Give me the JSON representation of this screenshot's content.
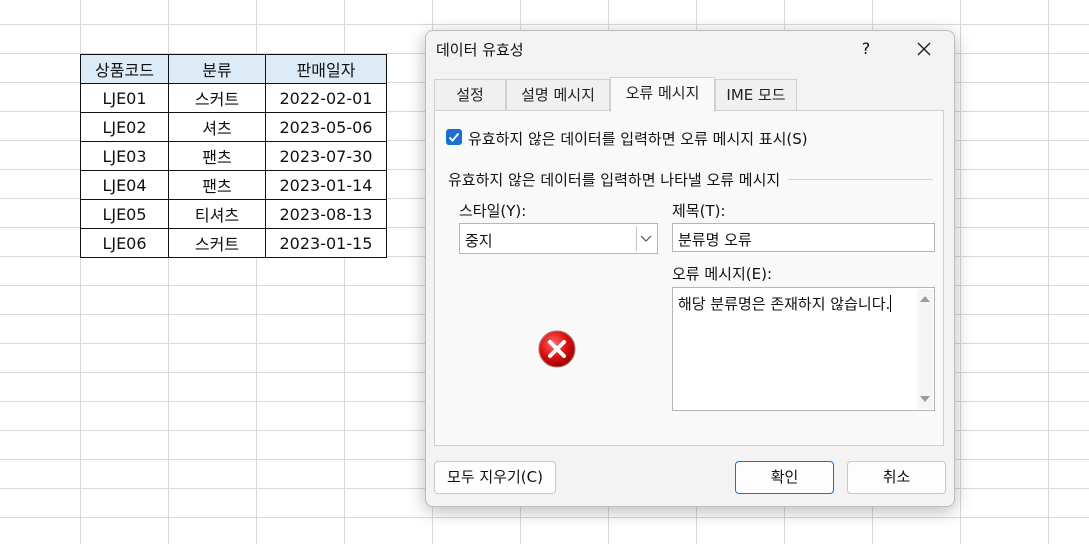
{
  "sheet": {
    "headers": [
      "상품코드",
      "분류",
      "판매일자"
    ],
    "rows": [
      [
        "LJE01",
        "스커트",
        "2022-02-01"
      ],
      [
        "LJE02",
        "셔츠",
        "2023-05-06"
      ],
      [
        "LJE03",
        "팬츠",
        "2023-07-30"
      ],
      [
        "LJE04",
        "팬츠",
        "2023-01-14"
      ],
      [
        "LJE05",
        "티셔츠",
        "2023-08-13"
      ],
      [
        "LJE06",
        "스커트",
        "2023-01-15"
      ]
    ]
  },
  "dialog": {
    "title": "데이터 유효성",
    "help": "?",
    "close": "✕",
    "tabs": [
      "설정",
      "설명 메시지",
      "오류 메시지",
      "IME 모드"
    ],
    "active_tab": "오류 메시지",
    "show_error_checkbox": "유효하지 않은 데이터를 입력하면 오류 메시지 표시(S)",
    "group_title": "유효하지 않은 데이터를 입력하면 나타낼 오류 메시지",
    "style_label": "스타일(Y):",
    "style_value": "중지",
    "title_label": "제목(T):",
    "title_value": "분류명 오류",
    "message_label": "오류 메시지(E):",
    "message_value": "해당 분류명은 존재하지 않습니다.",
    "clear_all": "모두 지우기(C)",
    "ok": "확인",
    "cancel": "취소",
    "icon_stop": "error-stop-icon",
    "accent_color": "#1a6fcf",
    "header_fill": "#ddebf7"
  }
}
